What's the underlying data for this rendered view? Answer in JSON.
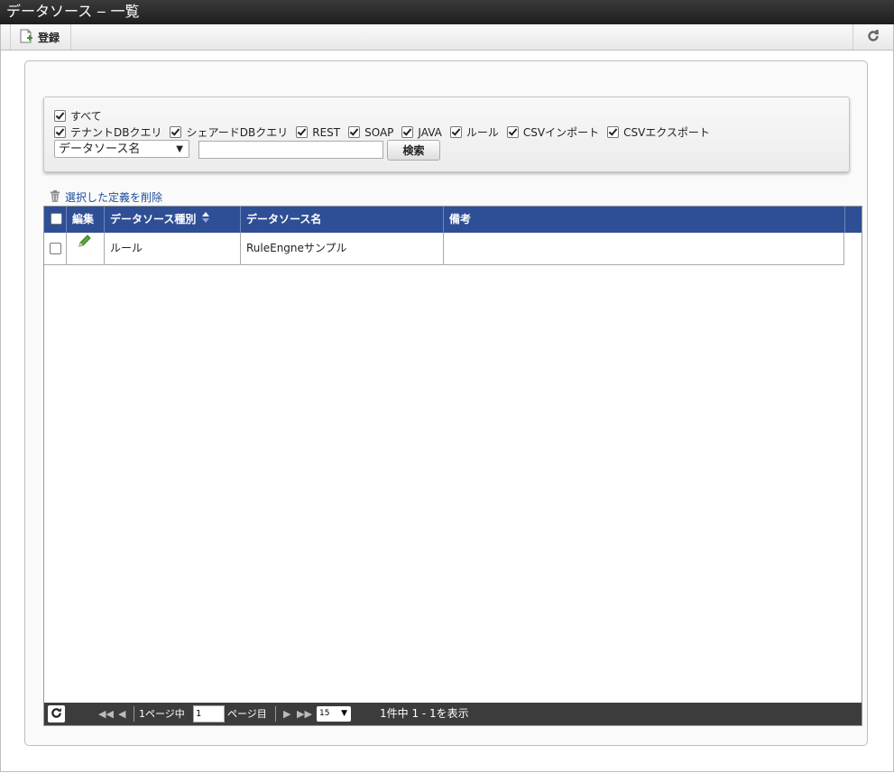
{
  "window": {
    "title": "データソース ‒ 一覧"
  },
  "toolbar": {
    "register_label": "登録",
    "refresh_icon": "refresh-icon"
  },
  "filter": {
    "all_label": "すべて",
    "options": [
      {
        "label": "テナントDBクエリ",
        "checked": true
      },
      {
        "label": "シェアードDBクエリ",
        "checked": true
      },
      {
        "label": "REST",
        "checked": true
      },
      {
        "label": "SOAP",
        "checked": true
      },
      {
        "label": "JAVA",
        "checked": true
      },
      {
        "label": "ルール",
        "checked": true
      },
      {
        "label": "CSVインポート",
        "checked": true
      },
      {
        "label": "CSVエクスポート",
        "checked": true
      }
    ],
    "search_field": "データソース名",
    "search_value": "",
    "search_button": "検索"
  },
  "actions": {
    "delete_label": "選択した定義を削除"
  },
  "table": {
    "headers": {
      "edit": "編集",
      "type": "データソース種別",
      "name": "データソース名",
      "note": "備考"
    },
    "rows": [
      {
        "type": "ルール",
        "name": "RuleEngneサンプル",
        "note": ""
      }
    ]
  },
  "pager": {
    "page_prefix": "1ページ中",
    "page_value": "1",
    "page_suffix": "ページ目",
    "rows_per_page": "15",
    "summary": "1件中 1 - 1を表示"
  }
}
